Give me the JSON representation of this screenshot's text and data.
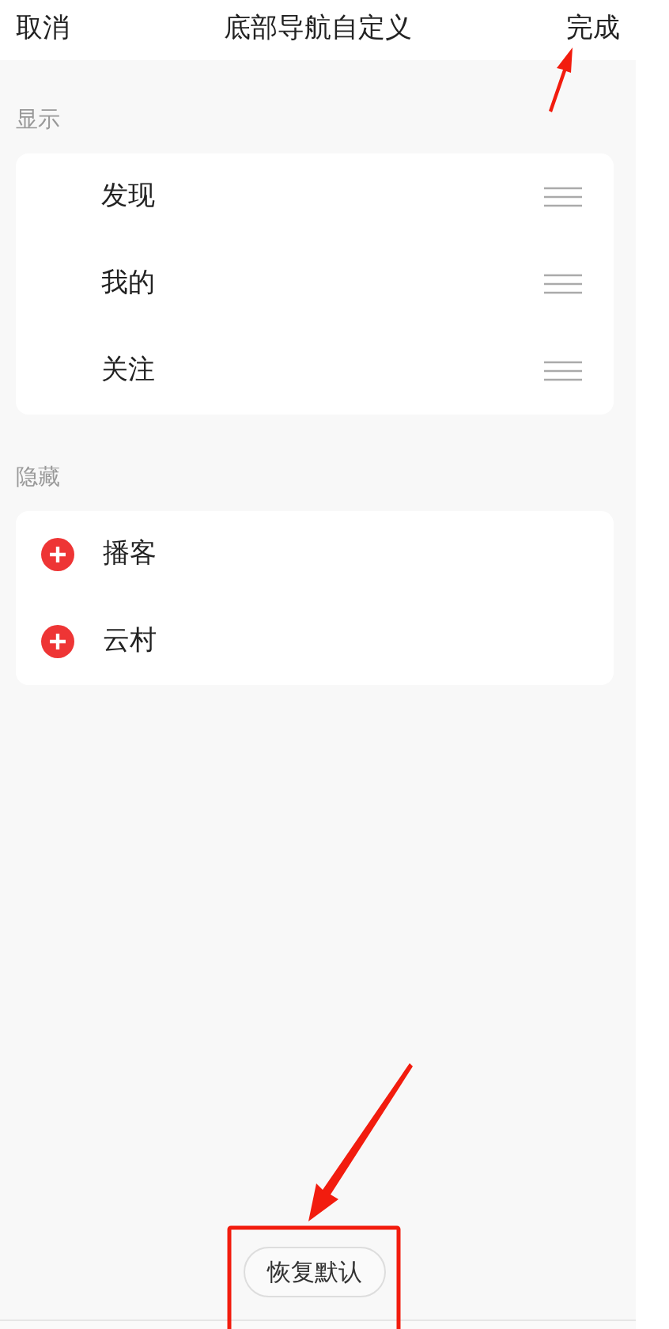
{
  "header": {
    "cancel": "取消",
    "title": "底部导航自定义",
    "done": "完成"
  },
  "sections": [
    {
      "label": "显示",
      "items": [
        {
          "label": "发现",
          "kind": "shown"
        },
        {
          "label": "我的",
          "kind": "shown"
        },
        {
          "label": "关注",
          "kind": "shown"
        }
      ]
    },
    {
      "label": "隐藏",
      "items": [
        {
          "label": "播客",
          "kind": "hidden"
        },
        {
          "label": "云村",
          "kind": "hidden"
        }
      ]
    }
  ],
  "reset_button": "恢复默认",
  "annotations": [
    {
      "kind": "arrow"
    },
    {
      "kind": "arrow"
    },
    {
      "kind": "box"
    }
  ]
}
